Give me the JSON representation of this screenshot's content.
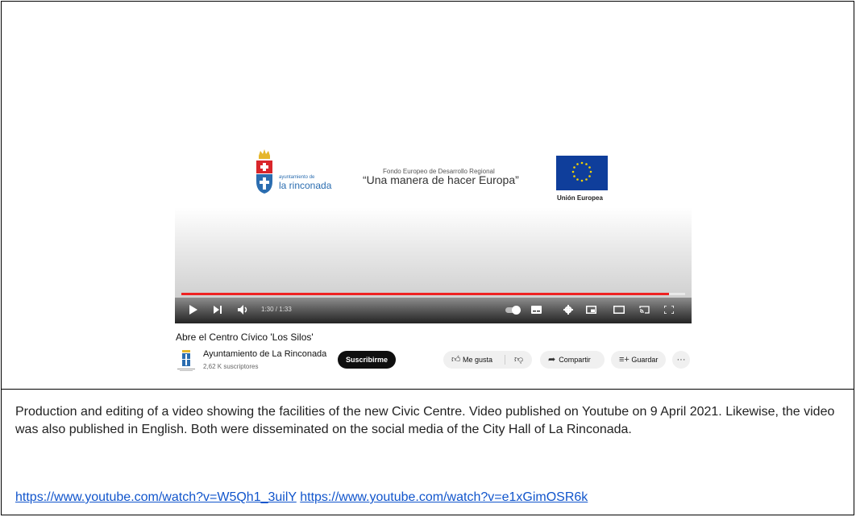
{
  "player": {
    "rinconada_small": "ayuntamiento de",
    "rinconada_big": "la rinconada",
    "feder_small": "Fondo Europeo de Desarrollo Regional",
    "feder_big": "“Una manera de hacer Europa”",
    "eu_label": "Unión Europea",
    "time": "1:30 / 1:33",
    "progress": 0.968,
    "icons": [
      "play-icon",
      "next-icon",
      "volume-icon",
      "autoplay-toggle",
      "subtitles-icon",
      "settings-icon",
      "miniplayer-icon",
      "theater-icon",
      "cast-icon",
      "fullscreen-icon"
    ]
  },
  "video": {
    "title": "Abre el Centro Cívico 'Los Silos'",
    "channel": "Ayuntamiento de La Rinconada",
    "subscribers": "2,62 K suscriptores",
    "subscribe_label": "Suscribirme",
    "like_label": "Me gusta",
    "share_label": "Compartir",
    "save_label": "Guardar"
  },
  "description": {
    "text": "Production and editing of a video showing the facilities of the new Civic Centre. Video published on Youtube on 9 April 2021. Likewise, the video was also published in English. Both were disseminated on the social media of the City Hall of La Rinconada.",
    "link1": "https://www.youtube.com/watch?v=W5Qh1_3uilY",
    "link2": "https://www.youtube.com/watch?v=e1xGimOSR6k"
  }
}
